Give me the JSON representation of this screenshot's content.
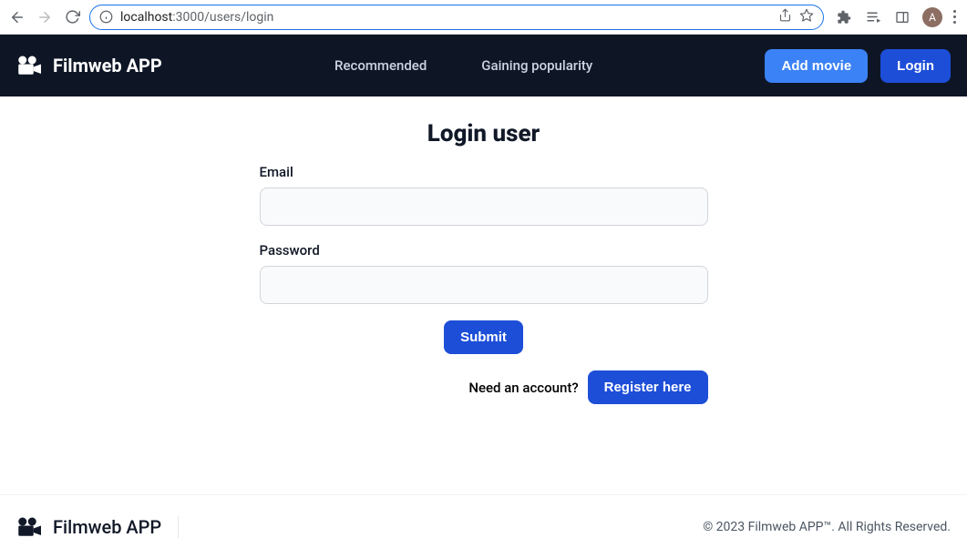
{
  "browser": {
    "url_host": "localhost",
    "url_port_path": ":3000/users/login",
    "avatar_initial": "A"
  },
  "header": {
    "brand": "Filmweb APP",
    "nav": {
      "recommended": "Recommended",
      "gaining": "Gaining popularity"
    },
    "actions": {
      "add_movie": "Add movie",
      "login": "Login"
    }
  },
  "form": {
    "title": "Login user",
    "email_label": "Email",
    "email_value": "",
    "password_label": "Password",
    "password_value": "",
    "submit_label": "Submit",
    "need_account": "Need an account?",
    "register_label": "Register here"
  },
  "footer": {
    "brand": "Filmweb APP",
    "copyright": "© 2023 Filmweb APP™. All Rights Reserved."
  }
}
